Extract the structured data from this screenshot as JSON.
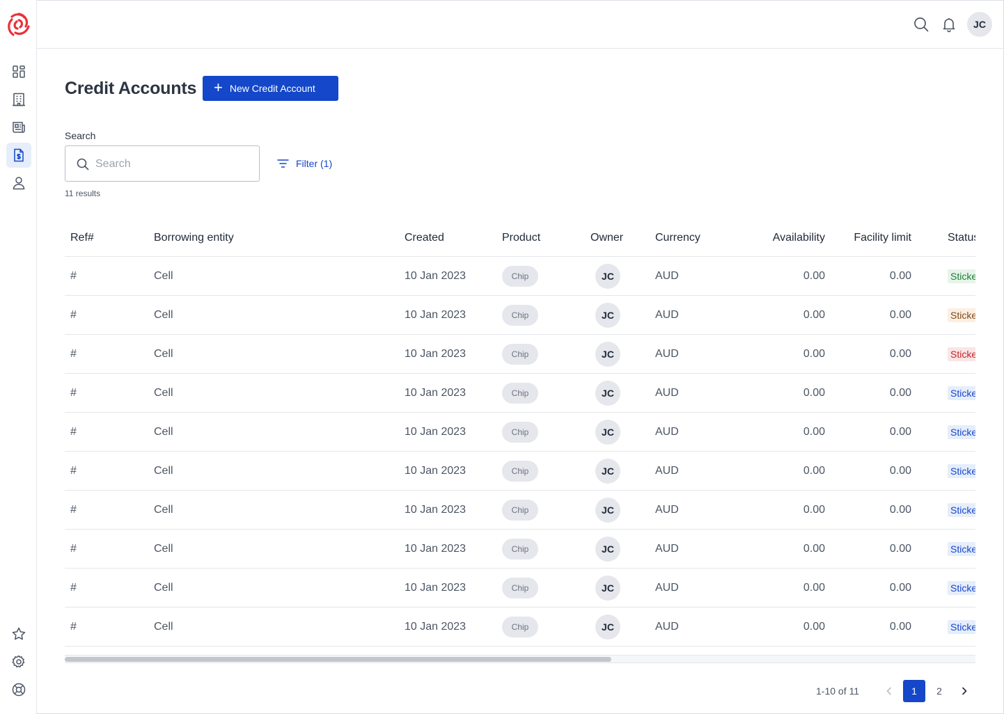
{
  "sidebar": {
    "items": [
      {
        "icon": "dashboard-grid-icon",
        "active": false
      },
      {
        "icon": "building-icon",
        "active": false
      },
      {
        "icon": "newspaper-icon",
        "active": false
      },
      {
        "icon": "document-dollar-icon",
        "active": true
      },
      {
        "icon": "user-icon",
        "active": false
      }
    ],
    "bottom_items": [
      {
        "icon": "star-icon"
      },
      {
        "icon": "gear-icon"
      },
      {
        "icon": "lifebuoy-icon"
      }
    ]
  },
  "topbar": {
    "avatar_initials": "JC"
  },
  "page": {
    "title": "Credit Accounts",
    "new_button_label": "New Credit Account",
    "new_button_icon": "plus-icon"
  },
  "search": {
    "label": "Search",
    "placeholder": "Search",
    "value": ""
  },
  "filter": {
    "label": "Filter (1)"
  },
  "results_text": "11 results",
  "table": {
    "columns": [
      "Ref#",
      "Borrowing entity",
      "Created",
      "Product",
      "Owner",
      "Currency",
      "Availability",
      "Facility limit",
      "Status"
    ],
    "rows": [
      {
        "ref": "#",
        "entity": "Cell",
        "created": "10 Jan 2023",
        "product": "Chip",
        "owner": "JC",
        "currency": "AUD",
        "availability": "0.00",
        "limit": "0.00",
        "status": "Sticker",
        "status_color": "#1e7b34",
        "status_variant": "green"
      },
      {
        "ref": "#",
        "entity": "Cell",
        "created": "10 Jan 2023",
        "product": "Chip",
        "owner": "JC",
        "currency": "AUD",
        "availability": "0.00",
        "limit": "0.00",
        "status": "Sticker",
        "status_color": "#7a4a1a",
        "status_variant": "orange"
      },
      {
        "ref": "#",
        "entity": "Cell",
        "created": "10 Jan 2023",
        "product": "Chip",
        "owner": "JC",
        "currency": "AUD",
        "availability": "0.00",
        "limit": "0.00",
        "status": "Sticker",
        "status_color": "#c0262d",
        "status_variant": "red"
      },
      {
        "ref": "#",
        "entity": "Cell",
        "created": "10 Jan 2023",
        "product": "Chip",
        "owner": "JC",
        "currency": "AUD",
        "availability": "0.00",
        "limit": "0.00",
        "status": "Sticker",
        "status_color": "#1447c9",
        "status_variant": "blue"
      },
      {
        "ref": "#",
        "entity": "Cell",
        "created": "10 Jan 2023",
        "product": "Chip",
        "owner": "JC",
        "currency": "AUD",
        "availability": "0.00",
        "limit": "0.00",
        "status": "Sticker",
        "status_color": "#1447c9",
        "status_variant": "blue"
      },
      {
        "ref": "#",
        "entity": "Cell",
        "created": "10 Jan 2023",
        "product": "Chip",
        "owner": "JC",
        "currency": "AUD",
        "availability": "0.00",
        "limit": "0.00",
        "status": "Sticker",
        "status_color": "#1447c9",
        "status_variant": "blue"
      },
      {
        "ref": "#",
        "entity": "Cell",
        "created": "10 Jan 2023",
        "product": "Chip",
        "owner": "JC",
        "currency": "AUD",
        "availability": "0.00",
        "limit": "0.00",
        "status": "Sticker",
        "status_color": "#1447c9",
        "status_variant": "blue"
      },
      {
        "ref": "#",
        "entity": "Cell",
        "created": "10 Jan 2023",
        "product": "Chip",
        "owner": "JC",
        "currency": "AUD",
        "availability": "0.00",
        "limit": "0.00",
        "status": "Sticker",
        "status_color": "#1447c9",
        "status_variant": "blue"
      },
      {
        "ref": "#",
        "entity": "Cell",
        "created": "10 Jan 2023",
        "product": "Chip",
        "owner": "JC",
        "currency": "AUD",
        "availability": "0.00",
        "limit": "0.00",
        "status": "Sticker",
        "status_color": "#1447c9",
        "status_variant": "blue"
      },
      {
        "ref": "#",
        "entity": "Cell",
        "created": "10 Jan 2023",
        "product": "Chip",
        "owner": "JC",
        "currency": "AUD",
        "availability": "0.00",
        "limit": "0.00",
        "status": "Sticker",
        "status_color": "#1447c9",
        "status_variant": "blue"
      }
    ]
  },
  "pagination": {
    "range_text": "1-10 of 11",
    "pages": [
      "1",
      "2"
    ],
    "current_page": "1"
  },
  "colors": {
    "brand": "#e8323b",
    "primary": "#1447c9"
  }
}
